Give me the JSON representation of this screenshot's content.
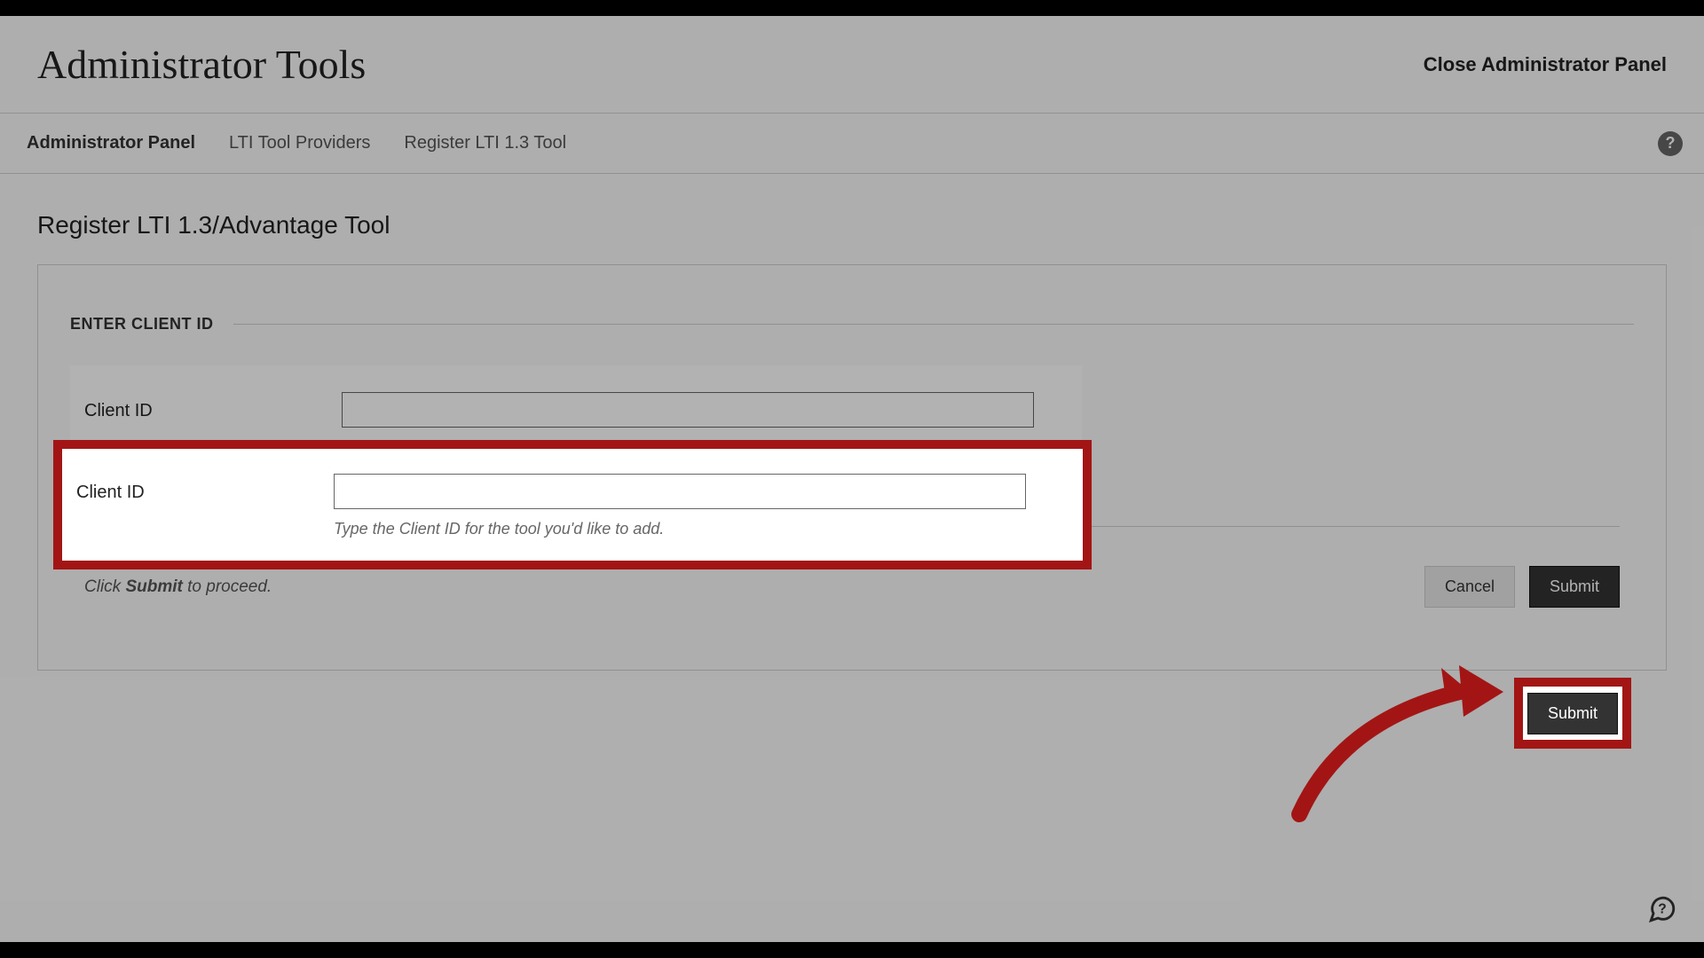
{
  "header": {
    "title": "Administrator Tools",
    "close_link": "Close Administrator Panel"
  },
  "breadcrumbs": {
    "items": [
      "Administrator Panel",
      "LTI Tool Providers",
      "Register LTI 1.3 Tool"
    ]
  },
  "page": {
    "title": "Register LTI 1.3/Advantage Tool",
    "section_label": "ENTER CLIENT ID"
  },
  "form": {
    "client_id_label": "Client ID",
    "client_id_value": "",
    "client_id_help": "Type the Client ID for the tool you'd like to add."
  },
  "footer": {
    "hint_prefix": "Click ",
    "hint_bold": "Submit",
    "hint_suffix": " to proceed.",
    "cancel_label": "Cancel",
    "submit_label": "Submit"
  },
  "icons": {
    "help": "?",
    "chat": "chat"
  },
  "annotation": {
    "highlight_color": "#a31515"
  }
}
